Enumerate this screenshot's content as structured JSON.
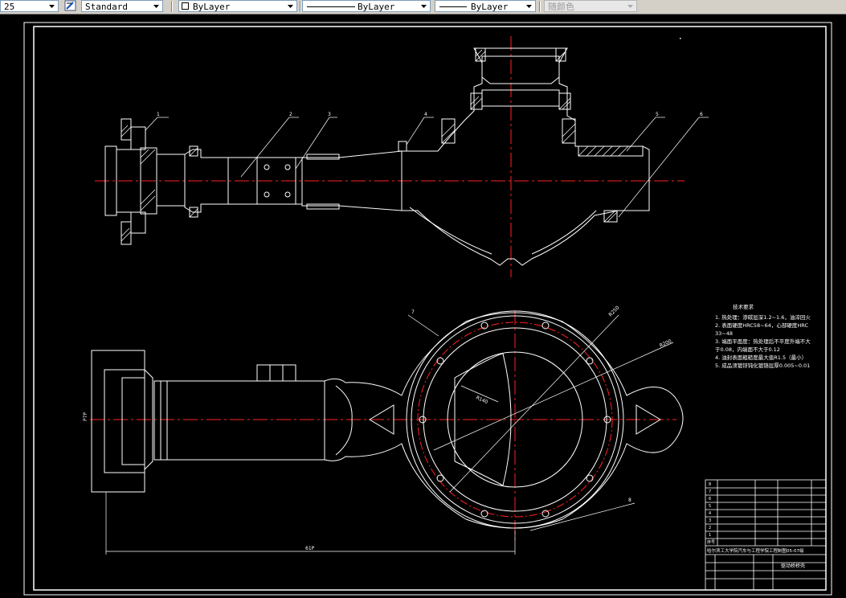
{
  "toolbar": {
    "scale_value": "25",
    "text_style": "Standard",
    "layer": "ByLayer",
    "linetype": "ByLayer",
    "lineweight": "ByLayer",
    "plot_style": "随颜色"
  },
  "drawing": {
    "dimension_bottom": "61P",
    "dimension_left": "P7P",
    "radius_1": "R250",
    "radius_2": "R200",
    "radius_3": "R140",
    "callouts": [
      "1",
      "2",
      "3",
      "4",
      "5",
      "6",
      "7",
      "8",
      "9"
    ]
  },
  "tech_req": {
    "title": "技术要求",
    "lines": [
      "1. 热处理：渗碳层深1.2~1.6，油淬回火",
      "2. 表面硬度HRC58~64，心部硬度HRC",
      "   33~48",
      "3. 端面平面度：热处理后不平度外端不大",
      "   于0.08，内端面不大于0.12",
      "4. 油封表面粗糙度最大值R1.5（最小）",
      "5. 成品须镀锌钝化镀铬层厚0.005~0.01"
    ]
  },
  "title_block": {
    "school": "哈尔滨工大学院汽车与工程学院工程制图05-07级",
    "part_name": "驱动桥桥壳",
    "row_labels": [
      "8",
      "7",
      "6",
      "5",
      "4",
      "3",
      "2",
      "1",
      "序号"
    ]
  },
  "colors": {
    "background": "#000000",
    "line_white": "#ffffff",
    "centerline_red": "#ff2020",
    "toolbar_bg": "#d4d0c8"
  }
}
